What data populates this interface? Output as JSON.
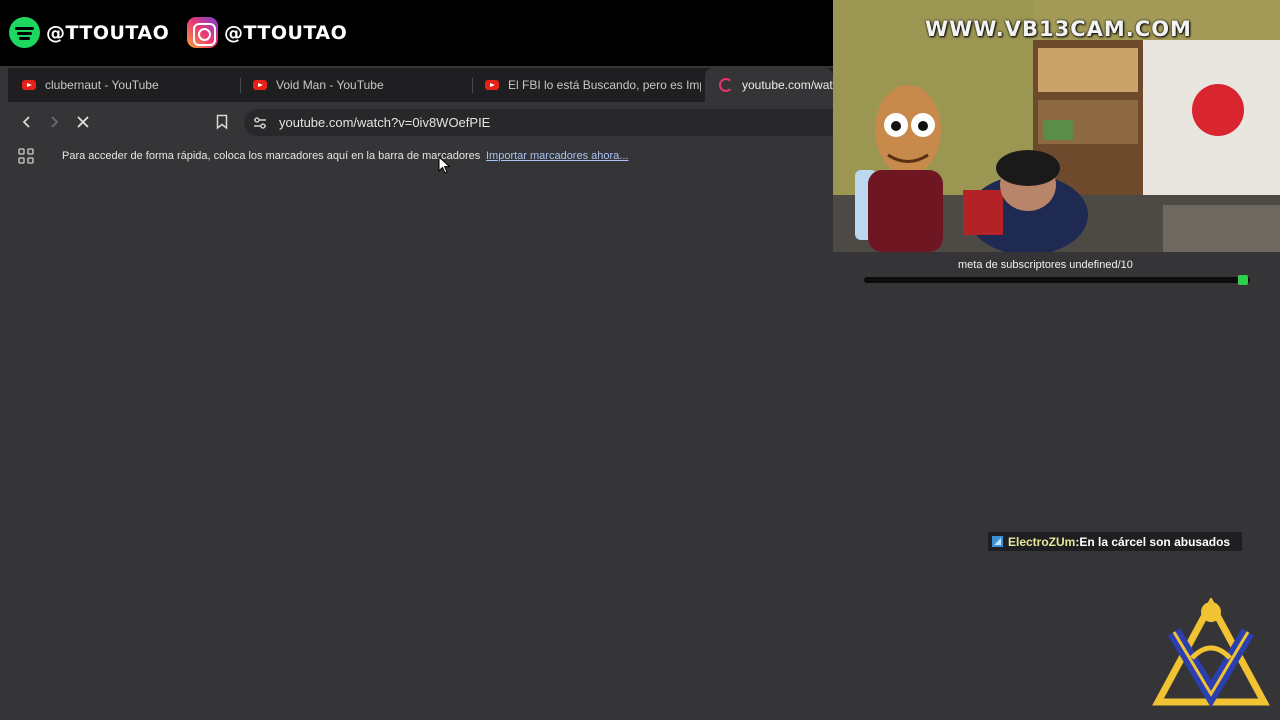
{
  "social": {
    "spotify_handle": "@TTOUTAO",
    "instagram_handle": "@TTOUTAO"
  },
  "browser": {
    "tabs": [
      {
        "label": "clubernaut - YouTube",
        "icon": "youtube-icon"
      },
      {
        "label": "Void Man - YouTube",
        "icon": "youtube-icon"
      },
      {
        "label": "El FBI lo está Buscando, pero es Impo",
        "icon": "youtube-icon"
      },
      {
        "label": "youtube.com/watc",
        "icon": "loading-icon",
        "active": true
      }
    ],
    "url": "youtube.com/watch?v=0iv8WOefPIE",
    "bookmarks_hint": "Para acceder de forma rápida, coloca los marcadores aquí en la barra de marcadores",
    "bookmarks_link": "Importar marcadores ahora..."
  },
  "stream": {
    "cam_title": "WWW.VB13CAM.COM",
    "goal_text": "meta de subscriptores undefined/10",
    "chat": {
      "user": "ElectroZUm",
      "separator": " : ",
      "message": "En la cárcel son abusados"
    }
  },
  "colors": {
    "page_bg": "#353538",
    "tab_bg": "#1f1f22",
    "spotify": "#1ed760",
    "goal_accent": "#2fd14c",
    "link": "#a9c2f4"
  }
}
